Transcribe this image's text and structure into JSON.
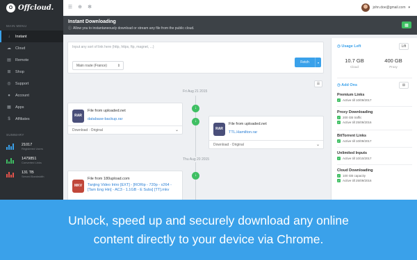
{
  "brand": {
    "name": "Offcloud."
  },
  "topbar": {
    "user_email": "john.doe@gmail.com"
  },
  "sidebar": {
    "main_menu_title": "MAIN MENU",
    "items": [
      {
        "label": "Instant",
        "icon": "download-icon",
        "active": true
      },
      {
        "label": "Cloud",
        "icon": "cloud-icon"
      },
      {
        "label": "Remote",
        "icon": "server-icon"
      },
      {
        "label": "Shop",
        "icon": "cart-icon"
      },
      {
        "label": "Support",
        "icon": "lifebuoy-icon"
      },
      {
        "label": "Account",
        "icon": "user-icon"
      },
      {
        "label": "Apps",
        "icon": "apps-icon"
      },
      {
        "label": "Affiliates",
        "icon": "dollar-icon"
      }
    ],
    "summary_title": "SUMMARY",
    "summary": [
      {
        "value": "21017",
        "label": "Registered Users",
        "color": "#3aa1ea"
      },
      {
        "value": "1479851",
        "label": "Converted Links",
        "color": "#3fbf63"
      },
      {
        "value": "131 TB",
        "label": "Served Bandwidth",
        "color": "#e5534b"
      }
    ]
  },
  "header": {
    "title": "Instant Downloading",
    "subtitle": "Allow you to instantaneously download or stream any file from the public cloud."
  },
  "input": {
    "placeholder": "Input any sort of link here (http, https, ftp, magnet, ...)",
    "route": "Main route (France)",
    "fetch_label": "Fetch"
  },
  "timeline": {
    "dates": [
      "Fri Aug 21 2015",
      "Thu Aug 20 2015"
    ],
    "cards": [
      {
        "from": "File from uploaded.net",
        "filename": "database-backup.rar",
        "icon_label": "RAR",
        "actions": "Download  ·  Original"
      },
      {
        "from": "File from uploaded.net",
        "filename": "TTL.Hamilton.rar",
        "icon_label": "RAR",
        "actions": "Download  ·  Original"
      },
      {
        "from": "File from 180upload.com",
        "filename": "Tanjing Video Intro [EXT] - [RORip - 720p - x264 - [Tam Eng Hin] - AC3 - 1.1GB - E Subs] [TT].mkv",
        "icon_label": "MKV",
        "actions": ""
      }
    ]
  },
  "right_panel": {
    "usage_title": "Usage Left",
    "usage_button": "Lift",
    "usage": [
      {
        "value": "10.7 GB",
        "label": "Cloud"
      },
      {
        "value": "400 GB",
        "label": "Proxy"
      }
    ],
    "addons_title": "Add Ons",
    "addons": [
      {
        "name": "Premium Links",
        "lines": [
          "Active till 10/09/2017"
        ]
      },
      {
        "name": "Proxy Downloading",
        "lines": [
          "200 GB traffic",
          "Active till 25/09/2016"
        ]
      },
      {
        "name": "BitTorrent Links",
        "lines": [
          "Active till 10/09/2017"
        ]
      },
      {
        "name": "Unlimited Inputs",
        "lines": [
          "Active till 10/10/2017"
        ]
      },
      {
        "name": "Cloud Downloading",
        "lines": [
          "100 GB capacity",
          "Active till 25/09/2016"
        ]
      }
    ]
  },
  "caption": {
    "line1": "Unlock, speed up and securely download any online",
    "line2": "content directly to your device via Chrome."
  },
  "colors": {
    "accent": "#3aa1ea",
    "success": "#3fbf63",
    "sidebar": "#2b2f33"
  }
}
